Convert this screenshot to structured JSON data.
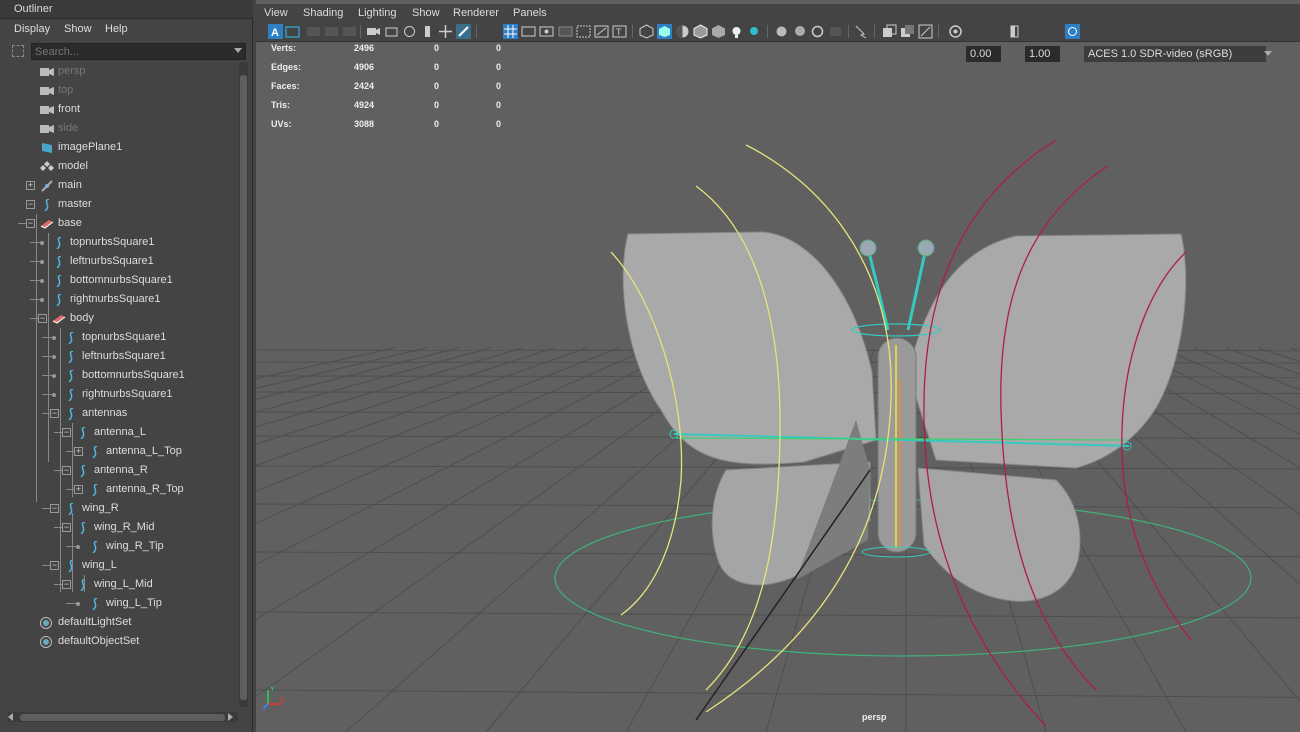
{
  "outliner": {
    "title": "Outliner",
    "menu": [
      "Display",
      "Show",
      "Help"
    ],
    "search_placeholder": "Search...",
    "items": [
      {
        "label": "persp",
        "icon": "camera-icon",
        "dim": true
      },
      {
        "label": "top",
        "icon": "camera-icon",
        "dim": true
      },
      {
        "label": "front",
        "icon": "camera-icon",
        "dim": false
      },
      {
        "label": "side",
        "icon": "camera-icon",
        "dim": true
      },
      {
        "label": "imagePlane1",
        "icon": "image-plane-icon"
      },
      {
        "label": "model",
        "icon": "group-icon"
      },
      {
        "label": "main",
        "icon": "joint-icon"
      },
      {
        "label": "master",
        "icon": "curve-icon"
      },
      {
        "label": "base",
        "icon": "geometry-icon"
      },
      {
        "label": "topnurbsSquare1",
        "icon": "curve-icon"
      },
      {
        "label": "leftnurbsSquare1",
        "icon": "curve-icon"
      },
      {
        "label": "bottomnurbsSquare1",
        "icon": "curve-icon"
      },
      {
        "label": "rightnurbsSquare1",
        "icon": "curve-icon"
      },
      {
        "label": "body",
        "icon": "geometry-icon"
      },
      {
        "label": "topnurbsSquare1",
        "icon": "curve-icon"
      },
      {
        "label": "leftnurbsSquare1",
        "icon": "curve-icon"
      },
      {
        "label": "bottomnurbsSquare1",
        "icon": "curve-icon"
      },
      {
        "label": "rightnurbsSquare1",
        "icon": "curve-icon"
      },
      {
        "label": "antennas",
        "icon": "curve-icon"
      },
      {
        "label": "antenna_L",
        "icon": "curve-icon"
      },
      {
        "label": "antenna_L_Top",
        "icon": "curve-icon"
      },
      {
        "label": "antenna_R",
        "icon": "curve-icon"
      },
      {
        "label": "antenna_R_Top",
        "icon": "curve-icon"
      },
      {
        "label": "wing_R",
        "icon": "curve-icon"
      },
      {
        "label": "wing_R_Mid",
        "icon": "curve-icon"
      },
      {
        "label": "wing_R_Tip",
        "icon": "curve-icon"
      },
      {
        "label": "wing_L",
        "icon": "curve-icon"
      },
      {
        "label": "wing_L_Mid",
        "icon": "curve-icon"
      },
      {
        "label": "wing_L_Tip",
        "icon": "curve-icon"
      },
      {
        "label": "defaultLightSet",
        "icon": "set-icon"
      },
      {
        "label": "defaultObjectSet",
        "icon": "set-icon"
      }
    ]
  },
  "viewport": {
    "menu": [
      "View",
      "Shading",
      "Lighting",
      "Show",
      "Renderer",
      "Panels"
    ],
    "exposure": "0.00",
    "gamma": "1.00",
    "color_space": "ACES 1.0 SDR-video (sRGB)",
    "camera_label": "persp",
    "hud": [
      {
        "label": "Verts:",
        "values": [
          "2496",
          "0",
          "0"
        ]
      },
      {
        "label": "Edges:",
        "values": [
          "4906",
          "0",
          "0"
        ]
      },
      {
        "label": "Faces:",
        "values": [
          "2424",
          "0",
          "0"
        ]
      },
      {
        "label": "Tris:",
        "values": [
          "4924",
          "0",
          "0"
        ]
      },
      {
        "label": "UVs:",
        "values": [
          "3088",
          "0",
          "0"
        ]
      }
    ],
    "colors": {
      "grid_line": "#4e4e4e",
      "background": "#606060",
      "wing": "#a9a9a9",
      "control_yellow": "#e8e27a",
      "control_red": "#b01c4a",
      "control_cyan": "#36c9c0",
      "ring_green": "#3fb27a"
    }
  }
}
